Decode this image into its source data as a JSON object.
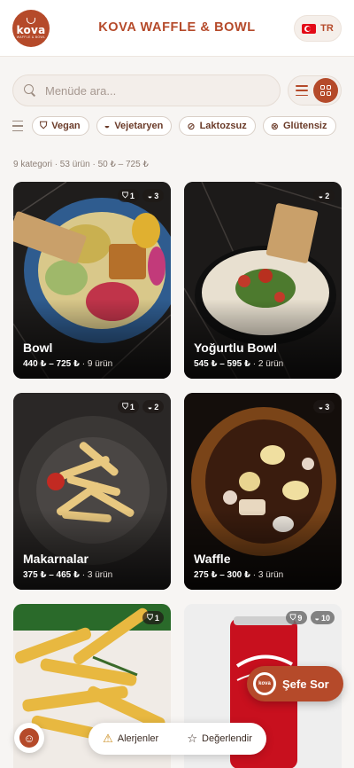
{
  "header": {
    "logo_word": "kova",
    "logo_sub": "WAFFLE & BOWL",
    "title": "KOVA WAFFLE & BOWL",
    "lang_label": "TR"
  },
  "search": {
    "placeholder": "Menüde ara...",
    "value": ""
  },
  "view": {
    "selected": "grid"
  },
  "filters": [
    {
      "label": "Vegan",
      "icon": "leaf-shield-icon"
    },
    {
      "label": "Vejetaryen",
      "icon": "salad-icon"
    },
    {
      "label": "Laktozsuz",
      "icon": "no-milk-icon"
    },
    {
      "label": "Glütensiz",
      "icon": "no-wheat-icon"
    }
  ],
  "summary": "9 kategori · 53 ürün · 50 ₺ – 725 ₺",
  "categories": [
    {
      "name": "Bowl",
      "price": "440 ₺ – 725 ₺",
      "count": "· 9 ürün",
      "badges": [
        {
          "icon": "vegan-icon",
          "count": "1"
        },
        {
          "icon": "vegetarian-icon",
          "count": "3"
        }
      ]
    },
    {
      "name": "Yoğurtlu Bowl",
      "price": "545 ₺ – 595 ₺",
      "count": "· 2 ürün",
      "badges": [
        {
          "icon": "vegetarian-icon",
          "count": "2"
        }
      ]
    },
    {
      "name": "Makarnalar",
      "price": "375 ₺ – 465 ₺",
      "count": "· 3 ürün",
      "badges": [
        {
          "icon": "vegan-icon",
          "count": "1"
        },
        {
          "icon": "vegetarian-icon",
          "count": "2"
        }
      ]
    },
    {
      "name": "Waffle",
      "price": "275 ₺ – 300 ₺",
      "count": "· 3 ürün",
      "badges": [
        {
          "icon": "vegetarian-icon",
          "count": "3"
        }
      ]
    },
    {
      "name": "",
      "price": "",
      "count": "",
      "badges": [
        {
          "icon": "vegan-icon",
          "count": "1"
        }
      ]
    },
    {
      "name": "",
      "price": "",
      "count": "",
      "badges": [
        {
          "icon": "vegan-icon",
          "count": "9"
        },
        {
          "icon": "vegetarian-icon",
          "count": "10"
        }
      ]
    }
  ],
  "chef_button": {
    "label": "Şefe Sor",
    "logo_word": "kova"
  },
  "bottom_bar": {
    "allergens_label": "Alerjenler",
    "rate_label": "Değerlendir"
  },
  "colors": {
    "accent": "#b54a2a",
    "background": "#f7f5f3"
  }
}
